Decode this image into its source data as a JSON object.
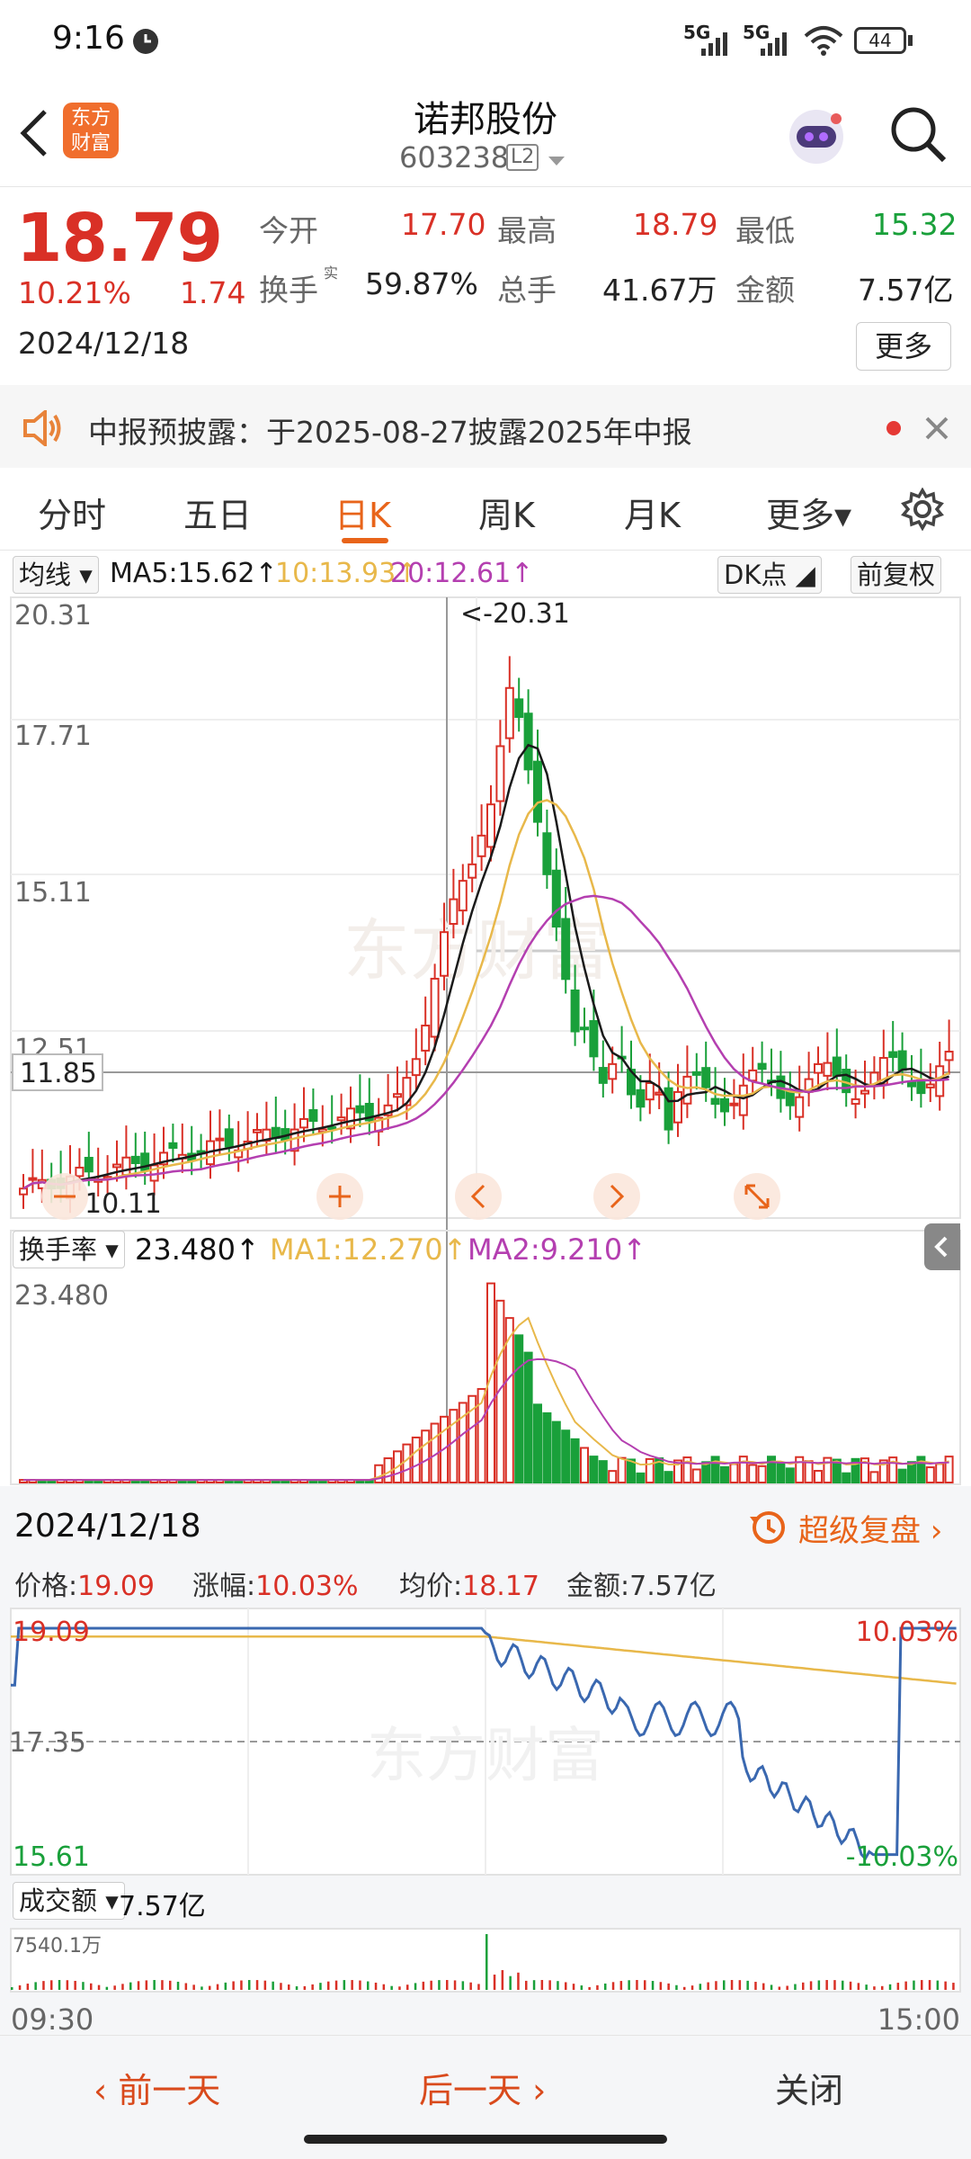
{
  "status": {
    "time": "9:16",
    "battery": "44",
    "network1": "5G",
    "network2": "5G"
  },
  "header": {
    "stock_name": "诺邦股份",
    "stock_code": "603238",
    "level": "L2",
    "brand_line1": "东方",
    "brand_line2": "财富"
  },
  "quote": {
    "price": "18.79",
    "change_pct": "10.21%",
    "change_amt": "1.74",
    "date": "2024/12/18",
    "open_label": "今开",
    "open": "17.70",
    "high_label": "最高",
    "high": "18.79",
    "low_label": "最低",
    "low": "15.32",
    "turnover_label": "换手",
    "turnover_sup": "实",
    "turnover": "59.87%",
    "volume_label": "总手",
    "volume": "41.67万",
    "amount_label": "金额",
    "amount": "7.57亿",
    "more_button": "更多"
  },
  "notice": {
    "text": "中报预披露：于2025-08-27披露2025年中报"
  },
  "tabs": [
    {
      "label": "分时"
    },
    {
      "label": "五日"
    },
    {
      "label": "日K"
    },
    {
      "label": "周K"
    },
    {
      "label": "月K"
    },
    {
      "label": "更多▾"
    }
  ],
  "kline": {
    "ma_selector": "均线",
    "ma5": "MA5:15.62↑",
    "ma10": "10:13.93↑",
    "ma20": "20:12.61↑",
    "dk_button": "DK点",
    "fq_button": "前复权",
    "y_labels": [
      "20.31",
      "17.71",
      "15.11",
      "12.51"
    ],
    "max_marker": "<-20.31",
    "crosshair_price": "11.85",
    "min_marker": "10.11",
    "colors": {
      "up": "#d93026",
      "down": "#19a03a",
      "ma5": "#1a1a1a",
      "ma10": "#e8b84a",
      "ma20": "#b43fb0"
    }
  },
  "turnover_panel": {
    "selector": "换手率",
    "value": "23.480↑",
    "ma1": "MA1:12.270↑",
    "ma2": "MA2:9.210↑",
    "y_max": "23.480"
  },
  "popup": {
    "date": "2024/12/18",
    "replay": "超级复盘 ›",
    "price_label": "价格:",
    "price": "19.09",
    "change_label": "涨幅:",
    "change": "10.03%",
    "avg_label": "均价:",
    "avg": "18.17",
    "amount_label": "金额:",
    "amount": "7.57亿",
    "y_top": "19.09",
    "y_mid": "17.35",
    "y_bottom": "15.61",
    "pct_top": "10.03%",
    "pct_bottom": "-10.03%",
    "vol_selector": "成交额",
    "vol_value": "7.57亿",
    "vol_max": "7540.1万",
    "time_start": "09:30",
    "time_end": "15:00"
  },
  "watermark": "东方财富",
  "bottom": {
    "prev": "‹ 前一天",
    "next": "后一天 ›",
    "close": "关闭"
  }
}
